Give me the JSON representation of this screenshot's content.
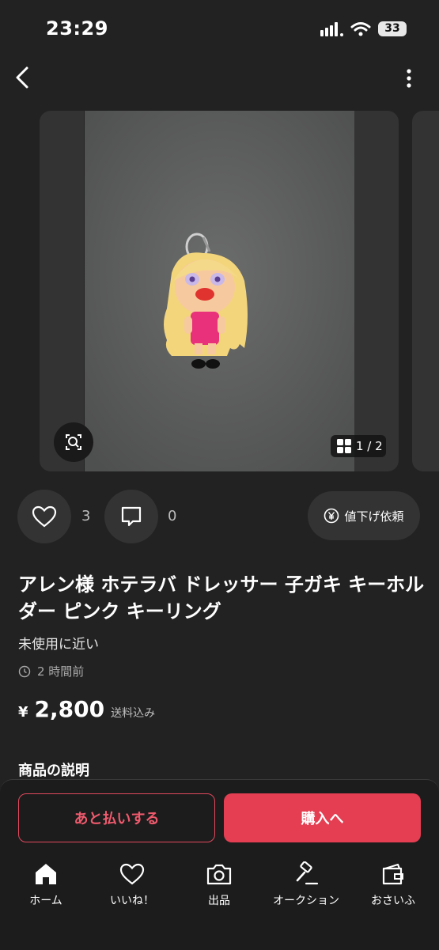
{
  "status_bar": {
    "time": "23:29",
    "battery": "33"
  },
  "header": {
    "back_icon": "chevron-left-icon",
    "more_icon": "more-vertical-icon"
  },
  "gallery": {
    "counter": "1 / 2",
    "scan_icon": "lens-search-icon",
    "grid_icon": "grid-icon"
  },
  "actions": {
    "like_count": "3",
    "comment_count": "0",
    "price_drop_label": "値下げ依頼"
  },
  "product": {
    "title": "アレン様 ホテラバ ドレッサー 子ガキ キーホルダー ピンク キーリング",
    "condition": "未使用に近い",
    "posted": "2 時間前",
    "currency": "¥",
    "price": "2,800",
    "shipping": "送料込み"
  },
  "description": {
    "heading": "商品の説明"
  },
  "buttons": {
    "pay_later": "あと払いする",
    "buy": "購入へ"
  },
  "nav": [
    {
      "label": "ホーム",
      "icon": "home-icon"
    },
    {
      "label": "いいね！",
      "icon": "heart-icon"
    },
    {
      "label": "出品",
      "icon": "camera-icon"
    },
    {
      "label": "オークション",
      "icon": "gavel-icon"
    },
    {
      "label": "おさいふ",
      "icon": "wallet-icon"
    }
  ],
  "colors": {
    "accent": "#e53e52",
    "background": "#222222",
    "surface": "#333333"
  }
}
